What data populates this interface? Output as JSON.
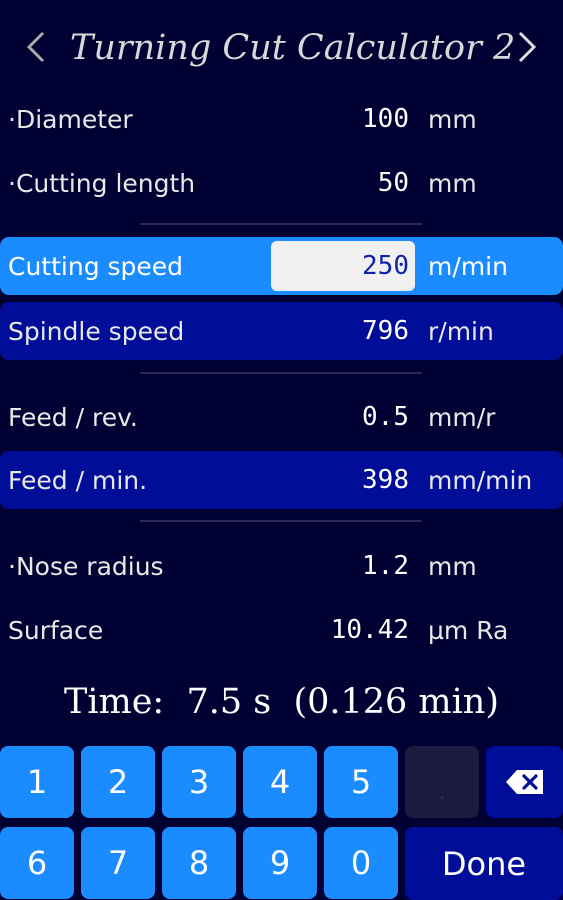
{
  "header": {
    "title": "Turning Cut Calculator 2",
    "prev_icon": "chevron-left-icon",
    "next_icon": "chevron-right-icon"
  },
  "rows": {
    "diameter": {
      "label": "·Diameter",
      "value": "100",
      "unit": "mm"
    },
    "cutting_length": {
      "label": "·Cutting length",
      "value": "50",
      "unit": "mm"
    },
    "cutting_speed": {
      "label": "Cutting speed",
      "value": "250",
      "unit": "m/min"
    },
    "spindle_speed": {
      "label": "Spindle speed",
      "value": "796",
      "unit": "r/min"
    },
    "feed_rev": {
      "label": "Feed / rev.",
      "value": "0.5",
      "unit": "mm/r"
    },
    "feed_min": {
      "label": "Feed / min.",
      "value": "398",
      "unit": "mm/min"
    },
    "nose_radius": {
      "label": "·Nose radius",
      "value": "1.2",
      "unit": "mm"
    },
    "surface": {
      "label": "Surface",
      "value": "10.42",
      "unit": "µm Ra"
    }
  },
  "result": {
    "time": "Time:  7.5 s  (0.126 min)"
  },
  "keypad": {
    "k1": "1",
    "k2": "2",
    "k3": "3",
    "k4": "4",
    "k5": "5",
    "k6": "6",
    "k7": "7",
    "k8": "8",
    "k9": "9",
    "k0": "0",
    "decimal": ".",
    "backspace_icon": "backspace-icon",
    "done": "Done"
  },
  "colors": {
    "background": "#000033",
    "active_row": "#1a8cff",
    "highlight_row": "#000d99",
    "key": "#1a8cff"
  }
}
